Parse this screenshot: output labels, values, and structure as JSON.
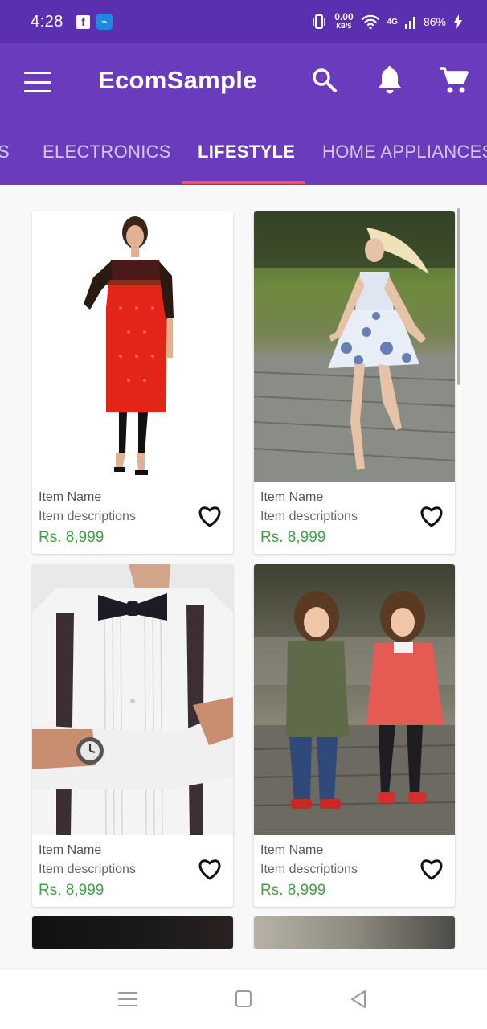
{
  "status_bar": {
    "time": "4:28",
    "net_speed_value": "0.00",
    "net_speed_unit": "KB/S",
    "network_label": "4G",
    "battery": "86%",
    "icons": [
      "facebook-icon",
      "usb-icon",
      "vibrate-icon",
      "wifi-icon",
      "signal-icon",
      "battery-charging-icon"
    ]
  },
  "app_bar": {
    "title": "EcomSample",
    "icons": [
      "menu-icon",
      "search-icon",
      "bell-icon",
      "cart-icon"
    ]
  },
  "tabs": [
    {
      "label": "S",
      "active": false
    },
    {
      "label": "ELECTRONICS",
      "active": false
    },
    {
      "label": "LIFESTYLE",
      "active": true
    },
    {
      "label": "HOME APPLIANCES",
      "active": false
    }
  ],
  "products": [
    {
      "name": "Item Name",
      "description": "Item descriptions",
      "price": "Rs. 8,999",
      "image": "red-kurta-photo"
    },
    {
      "name": "Item Name",
      "description": "Item descriptions",
      "price": "Rs. 8,999",
      "image": "dress-woman-photo"
    },
    {
      "name": "Item Name",
      "description": "Item descriptions",
      "price": "Rs. 8,999",
      "image": "bowtie-man-photo"
    },
    {
      "name": "Item Name",
      "description": "Item descriptions",
      "price": "Rs. 8,999",
      "image": "kids-photo"
    }
  ],
  "colors": {
    "status_bar": "#5a2fb0",
    "app_bar": "#6a3bbc",
    "tab_indicator": "#f0546a",
    "price": "#43a047"
  },
  "nav_bar": {
    "icons": [
      "recents-icon",
      "home-icon",
      "back-icon"
    ]
  }
}
